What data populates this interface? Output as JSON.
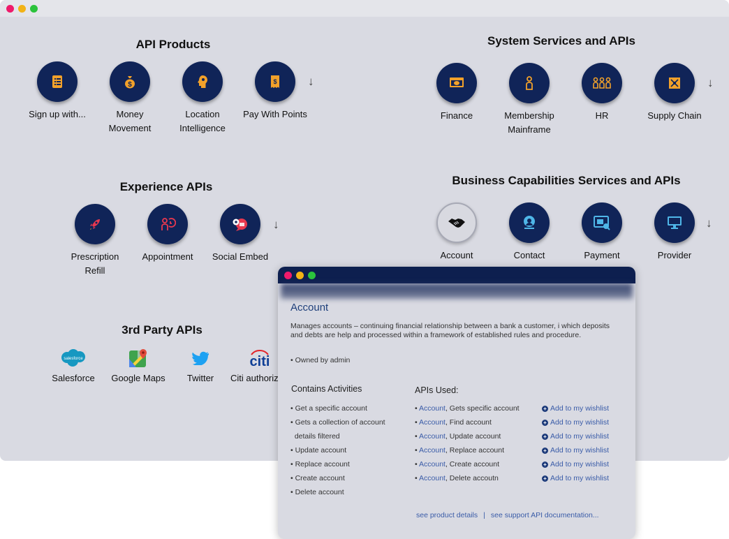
{
  "window": {
    "title": ""
  },
  "sections": {
    "api_products": {
      "title": "API Products",
      "items": [
        {
          "label": "Sign up with...",
          "icon": "checklist-icon"
        },
        {
          "label": "Money Movement",
          "icon": "money-bag-icon"
        },
        {
          "label": "Location Intelligence",
          "icon": "head-location-icon"
        },
        {
          "label": "Pay With Points",
          "icon": "receipt-dollar-icon"
        }
      ]
    },
    "system_services": {
      "title": "System Services and APIs",
      "items": [
        {
          "label": "Finance",
          "icon": "finance-screen-icon"
        },
        {
          "label": "Membership Mainframe",
          "icon": "member-icon"
        },
        {
          "label": "HR",
          "icon": "people-group-icon"
        },
        {
          "label": "Supply Chain",
          "icon": "supply-chain-icon"
        }
      ]
    },
    "experience": {
      "title": "Experience APIs",
      "items": [
        {
          "label": "Prescription Refill",
          "icon": "rocket-icon"
        },
        {
          "label": "Appointment",
          "icon": "appointment-icon"
        },
        {
          "label": "Social Embed",
          "icon": "social-chat-icon"
        }
      ]
    },
    "business": {
      "title": "Business Capabilities Services and APIs",
      "items": [
        {
          "label": "Account",
          "icon": "handshake-icon"
        },
        {
          "label": "Contact",
          "icon": "contact-icon"
        },
        {
          "label": "Payment",
          "icon": "payment-icon"
        },
        {
          "label": "Provider",
          "icon": "monitor-icon"
        }
      ]
    },
    "third_party": {
      "title": "3rd Party APIs",
      "items": [
        {
          "label": "Salesforce",
          "logo_text": "salesforce"
        },
        {
          "label": "Google Maps"
        },
        {
          "label": "Twitter"
        },
        {
          "label": "Citi authorize",
          "logo_text": "citi"
        }
      ]
    }
  },
  "arrow_glyph": "↓",
  "popup": {
    "title": "Account",
    "description": "Manages accounts – continuing financial relationship between a bank a customer, i which deposits and debts are help and processed within a framework of established rules and procedure.",
    "owner": "• Owned by admin",
    "activities_heading": "Contains Activities",
    "activities": [
      "• Get a specific account",
      "• Gets a collection of account",
      "  details filtered",
      "• Update account",
      "• Replace account",
      "• Create account",
      "• Delete account"
    ],
    "apis_heading": "APIs Used:",
    "apis": [
      {
        "bullet": "• ",
        "link": "Account",
        "rest": ", Gets specific account",
        "action": "Add to my wishlist"
      },
      {
        "bullet": "• ",
        "link": "Account",
        "rest": ", Find account",
        "action": "Add to my wishlist"
      },
      {
        "bullet": "• ",
        "link": "Account",
        "rest": ", Update account",
        "action": "Add to my wishlist"
      },
      {
        "bullet": "• ",
        "link": "Account",
        "rest": ", Replace account",
        "action": "Add to my wishlist"
      },
      {
        "bullet": "• ",
        "link": "Account",
        "rest": ", Create account",
        "action": "Add to my wishlist"
      },
      {
        "bullet": "• ",
        "link": "Account",
        "rest": ", Delete accoutn",
        "action": "Add to my wishlist"
      }
    ],
    "footer": {
      "product_details": "see product details",
      "separator": "|",
      "support_docs": "see support API documentation..."
    }
  },
  "colors": {
    "circle": "#102458",
    "icon": "#f2a12a",
    "link": "#3a5ca8",
    "popup_bar": "#0d1f4f"
  }
}
